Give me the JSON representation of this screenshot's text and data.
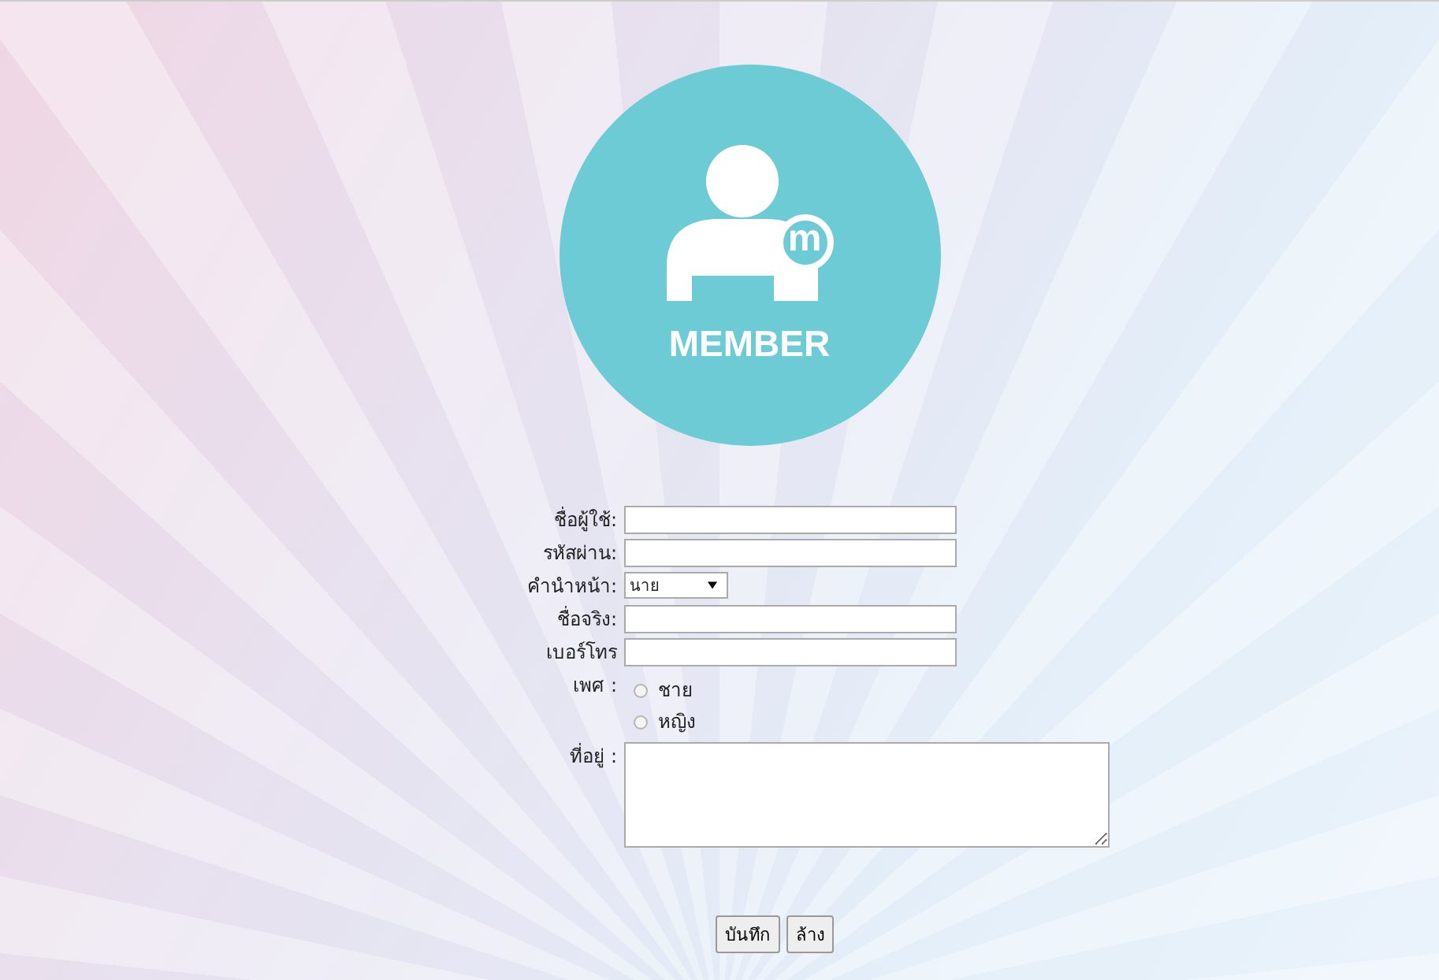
{
  "logo": {
    "badge": "m",
    "caption": "MEMBER"
  },
  "form": {
    "fields": [
      {
        "kind": "text",
        "label": "ชื่อผู้ใช้:"
      },
      {
        "kind": "text",
        "label": "รหัสผ่าน:"
      },
      {
        "kind": "select",
        "label": "คำนำหน้า:",
        "value": "นาย"
      },
      {
        "kind": "text",
        "label": "ชื่อจริง:"
      },
      {
        "kind": "text",
        "label": "เบอร์โทร"
      },
      {
        "kind": "radio",
        "label": "เพศ :",
        "options": [
          {
            "label": "ชาย",
            "selected": false
          },
          {
            "label": "หญิง",
            "selected": false
          }
        ]
      },
      {
        "kind": "textarea",
        "label": "ที่อยู่ :"
      }
    ]
  },
  "buttons": [
    "บันทึก",
    "ล้าง"
  ]
}
